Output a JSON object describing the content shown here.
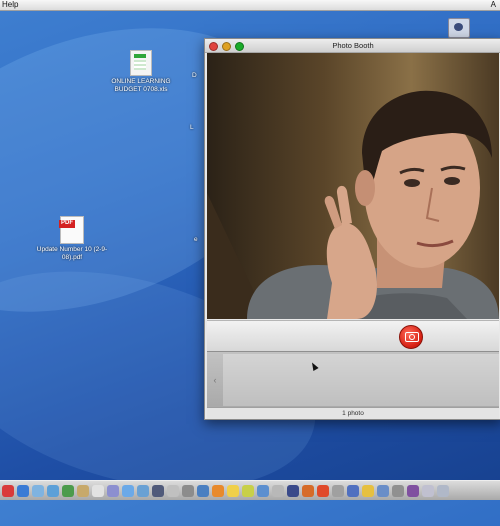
{
  "menubar": {
    "menu_help": "Help",
    "right_glyph": "A"
  },
  "desktop": {
    "icons": [
      {
        "type": "xls",
        "label": "ONLINE LEARNING BUDGET 0708.xls"
      },
      {
        "type": "pdf",
        "label": "Update Number 10 (2-9-08).pdf",
        "badge": "PDF"
      }
    ],
    "partial_labels": [
      "D",
      "L",
      "e"
    ]
  },
  "photobooth": {
    "title": "Photo Booth",
    "status": "1 photo",
    "tray_arrow": "‹"
  },
  "icons": {
    "camera": "camera-icon",
    "dock": [
      "finder-icon",
      "dashboard-icon",
      "mail-icon",
      "safari-icon",
      "ichat-icon",
      "address-book-icon",
      "ical-icon",
      "preview-icon",
      "itunes-icon",
      "iphoto-icon",
      "imovie-icon",
      "garageband-icon",
      "system-preferences-icon",
      "app-icon-14",
      "app-icon-15",
      "app-icon-16",
      "app-icon-17",
      "app-icon-18",
      "app-icon-19",
      "app-icon-20",
      "app-icon-21",
      "app-icon-22",
      "app-icon-23",
      "app-icon-24",
      "app-icon-25",
      "app-icon-26",
      "app-icon-27",
      "app-icon-28",
      "app-icon-29",
      "trash-icon"
    ]
  },
  "dock_colors": [
    "#d93a3a",
    "#3a7bd5",
    "#7fb3e0",
    "#5da0d8",
    "#4c9b4c",
    "#c7a96b",
    "#e2e2e2",
    "#8c8fd0",
    "#6ba9e8",
    "#6aa1d4",
    "#505a7a",
    "#c0c0c0",
    "#8c8c8c",
    "#4a7fc1",
    "#e88a2c",
    "#f0d04a",
    "#c8d048",
    "#5c8fcf",
    "#b8b8b8",
    "#3a4a8a",
    "#d66b28",
    "#e04a2a",
    "#a0a0a0",
    "#5070c0",
    "#e6c040",
    "#6a8ec8",
    "#909090",
    "#8050a0",
    "#c0c0d0",
    "#b0b8c8"
  ]
}
